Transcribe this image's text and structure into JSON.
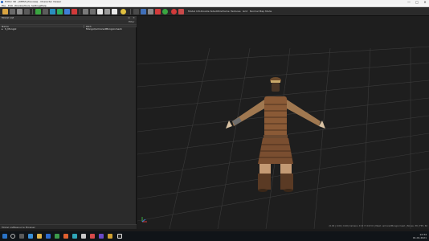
{
  "window": {
    "title": "Editor 3D - [MESH_Preview] - Character Viewer",
    "controls": [
      "—",
      "□",
      "✕"
    ]
  },
  "menubar": {
    "items": [
      "File",
      "Edit",
      "Window",
      "Tools",
      "Settings",
      "Help"
    ]
  },
  "toolbar": {
    "labels": [
      "Model Info",
      "Double Sided",
      "Wireframe",
      "Textures",
      "Grid",
      "Normal Map Mode"
    ],
    "colors": {
      "green_a": "#3aa641",
      "green_b": "#2fae5c",
      "red": "#d23a3a",
      "yellow": "#e0c040",
      "blue": "#3f7fd8",
      "white": "#e8e8e8"
    }
  },
  "panel": {
    "title": "Model List",
    "controls": [
      "⊡",
      "✕"
    ],
    "tools_label": "Filter",
    "columns": [
      "Name",
      "Path"
    ],
    "rows": [
      {
        "expand": "▸",
        "name": "S_Mongol",
        "path": "Mongol/armoredMongol.mesh"
      }
    ],
    "footer": [
      "Model List",
      "Resource Browser"
    ]
  },
  "viewport": {
    "status": "(0.00 | 0.00 | 0.00) Camera: X=0 Y=0 Z=0 | Mesh: armoredMongol.mesh | Bones: 38 | FPS: 60"
  },
  "taskbar": {
    "start_icon": "windows-logo-icon",
    "search_icon": "search-icon",
    "apps": [
      "task-view-icon",
      "browser-icon",
      "folder-icon",
      "mail-icon",
      "store-icon",
      "media-icon",
      "game-icon",
      "chat-icon",
      "terminal-icon",
      "editor-icon",
      "photo-icon",
      "app-icon"
    ],
    "time": "12:34",
    "date": "01.01.2021"
  }
}
